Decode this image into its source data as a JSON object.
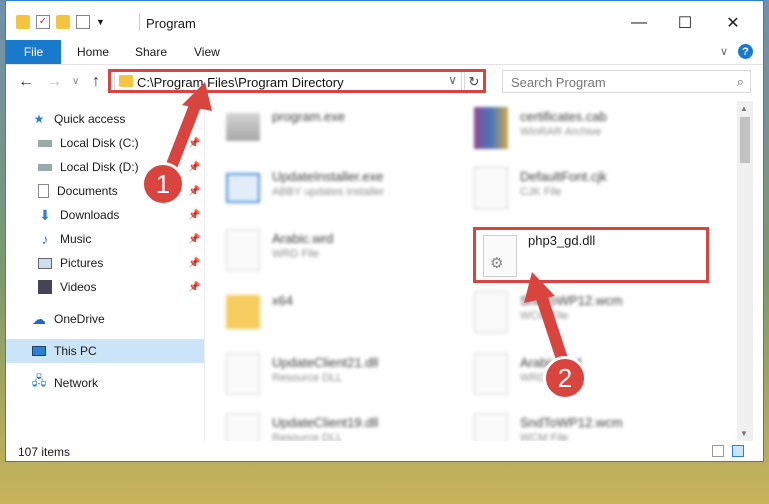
{
  "window": {
    "title": "Program",
    "minimize": "—",
    "maximize": "☐",
    "close": "✕"
  },
  "ribbon": {
    "file": "File",
    "home": "Home",
    "share": "Share",
    "view": "View",
    "help": "?",
    "expand": "∨"
  },
  "nav": {
    "back": "←",
    "forward": "→",
    "dropdown": "∨",
    "up": "↑"
  },
  "address": {
    "path": "C:\\Program Files\\Program Directory",
    "dropdown": "∨",
    "refresh": "↻"
  },
  "search": {
    "placeholder": "Search Program",
    "icon": "⌕"
  },
  "sidebar": {
    "items": [
      {
        "label": "Quick access",
        "icon": "star-icon"
      },
      {
        "label": "Local Disk (C:)",
        "icon": "drive-icon"
      },
      {
        "label": "Local Disk (D:)",
        "icon": "drive-icon"
      },
      {
        "label": "Documents",
        "icon": "documents-icon"
      },
      {
        "label": "Downloads",
        "icon": "download-icon"
      },
      {
        "label": "Music",
        "icon": "music-icon"
      },
      {
        "label": "Pictures",
        "icon": "pictures-icon"
      },
      {
        "label": "Videos",
        "icon": "videos-icon"
      },
      {
        "label": "OneDrive",
        "icon": "cloud-icon"
      },
      {
        "label": "This PC",
        "icon": "pc-icon"
      },
      {
        "label": "Network",
        "icon": "network-icon"
      }
    ],
    "pin": "📌"
  },
  "files": [
    {
      "name": "program.exe",
      "type": ""
    },
    {
      "name": "certificates.cab",
      "type": "WinRAR Archive"
    },
    {
      "name": "UpdateInstaller.exe",
      "type": "ABBY updates installer"
    },
    {
      "name": "DefaultFont.cjk",
      "type": "CJK File"
    },
    {
      "name": "Arabic.wrd",
      "type": "WRD File"
    },
    {
      "name": "php3_gd.dll",
      "type": ""
    },
    {
      "name": "x64",
      "type": ""
    },
    {
      "name": "SndToWP12.wcm",
      "type": "WCM File"
    },
    {
      "name": "UpdateClient21.dll",
      "type": "Resource DLL"
    },
    {
      "name": "Arabic.wrd",
      "type": "WRD File"
    },
    {
      "name": "UpdateClient19.dll",
      "type": "Resource DLL"
    },
    {
      "name": "SndToWP12.wcm",
      "type": "WCM File"
    }
  ],
  "status": {
    "count": "107 items"
  },
  "annotations": {
    "one": "1",
    "two": "2",
    "color": "#d9443f"
  }
}
